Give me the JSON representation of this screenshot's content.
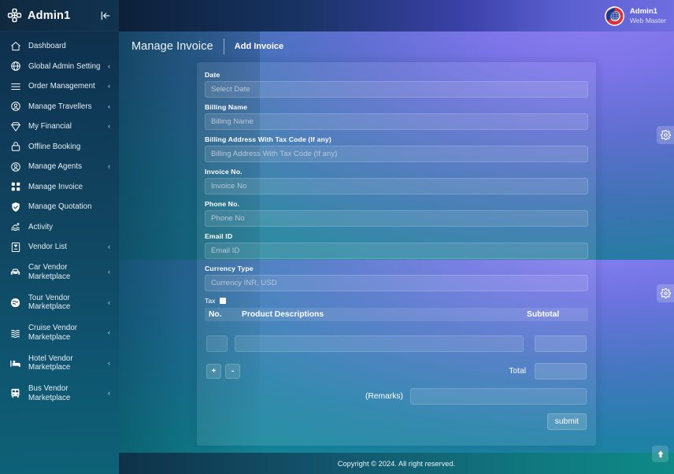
{
  "sidebar": {
    "brand": "Admin1",
    "collapse_icon": "collapse-left-icon",
    "items": [
      {
        "label": "Dashboard",
        "icon": "home-icon",
        "chevron": ""
      },
      {
        "label": "Global Admin Setting",
        "icon": "globe-icon",
        "chevron": "‹"
      },
      {
        "label": "Order Management",
        "icon": "menu-lines-icon",
        "chevron": "‹"
      },
      {
        "label": "Manage Travellers",
        "icon": "user-circle-icon",
        "chevron": "‹"
      },
      {
        "label": "My Financial",
        "icon": "diamond-icon",
        "chevron": "‹"
      },
      {
        "label": "Offline Booking",
        "icon": "lock-icon",
        "chevron": ""
      },
      {
        "label": "Manage Agents",
        "icon": "user-circle-icon",
        "chevron": "‹"
      },
      {
        "label": "Manage Invoice",
        "icon": "grid-squares-icon",
        "chevron": ""
      },
      {
        "label": "Manage Quotation",
        "icon": "shield-check-icon",
        "chevron": ""
      },
      {
        "label": "Activity",
        "icon": "activity-swim-icon",
        "chevron": ""
      },
      {
        "label": "Vendor List",
        "icon": "bookmark-tag-icon",
        "chevron": "‹"
      },
      {
        "label": "Car Vendor\nMarketplace",
        "icon": "car-icon",
        "chevron": "‹"
      },
      {
        "label": "Tour Vendor\nMarketplace",
        "icon": "tour-globe-icon",
        "chevron": "‹"
      },
      {
        "label": "Cruise Vendor\nMarketplace",
        "icon": "waves-icon",
        "chevron": "‹"
      },
      {
        "label": "Hotel Vendor\nMarketplace",
        "icon": "hotel-bed-icon",
        "chevron": "‹"
      },
      {
        "label": "Bus Vendor\nMarketplace",
        "icon": "bus-icon",
        "chevron": "‹"
      }
    ]
  },
  "topbar": {
    "user_name": "Admin1",
    "user_role": "Web Master",
    "avatar_icon": "globe-avatar-icon"
  },
  "tabs": {
    "main": "Manage Invoice",
    "sub": "Add Invoice"
  },
  "form": {
    "fields": [
      {
        "label": "Date",
        "placeholder": "Select Date",
        "value": "",
        "name": "date-field"
      },
      {
        "label": "Billing Name",
        "placeholder": "Billing Name",
        "value": "",
        "name": "billing-name-field"
      },
      {
        "label": "Billing Address With Tax Code (If any)",
        "placeholder": "Billing Address With Tax Code (If any)",
        "value": "",
        "name": "billing-address-field"
      },
      {
        "label": "Invoice No.",
        "placeholder": "Invoice No",
        "value": "",
        "name": "invoice-no-field"
      },
      {
        "label": "Phone No.",
        "placeholder": "Phone No",
        "value": "",
        "name": "phone-no-field"
      },
      {
        "label": "Email ID",
        "placeholder": "Email ID",
        "value": "",
        "name": "email-id-field"
      },
      {
        "label": "Currency Type",
        "placeholder": "Currency INR, USD",
        "value": "",
        "name": "currency-type-field"
      }
    ],
    "tax_label": "Tax",
    "tax_checked": false,
    "table": {
      "headers": [
        "No.",
        "Product Descriptions",
        "Subtotal"
      ],
      "rows": [
        {
          "no": "",
          "description": "",
          "subtotal": ""
        }
      ]
    },
    "add_row_label": "+",
    "remove_row_label": "-",
    "total_label": "Total",
    "total_value": "",
    "remarks_label": "(Remarks)",
    "remarks_value": "",
    "submit_label": "submit"
  },
  "side_buttons": {
    "gear_top": "gear-icon",
    "gear_bottom": "gear-icon",
    "scroll_top": "arrow-up-icon"
  },
  "footer": {
    "copyright": "Copyright © 2024. All right reserved."
  },
  "colors": {
    "accent_purple": "#6f6ee0",
    "accent_teal": "#0e8a88",
    "sidebar_dark": "#0d2c49",
    "avatar_red": "#d8343c",
    "avatar_blue": "#1b3a8f"
  }
}
